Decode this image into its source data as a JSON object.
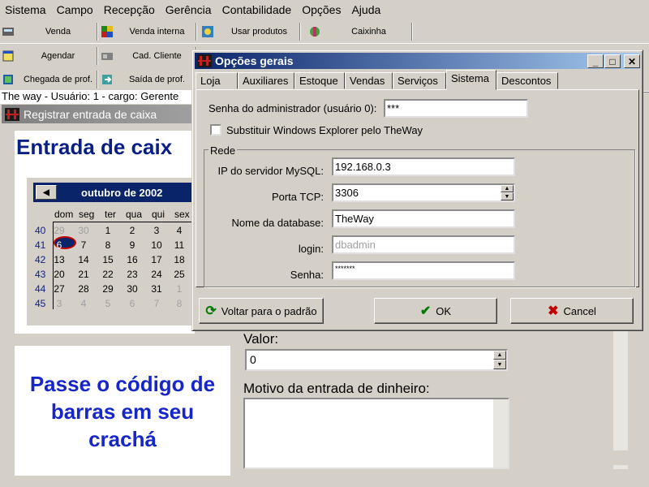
{
  "menu": [
    "Sistema",
    "Campo",
    "Recepção",
    "Gerência",
    "Contabilidade",
    "Opções",
    "Ajuda"
  ],
  "toolbar1": [
    "Venda",
    "Venda interna",
    "Usar produtos",
    "Caixinha"
  ],
  "toolbar2": [
    "Agendar",
    "Cad. Cliente"
  ],
  "toolbar3": [
    "Chegada de prof.",
    "Saída de prof."
  ],
  "status_line": "The way - Usuário: 1 - cargo: Gerente",
  "caixa": {
    "window_title": "Registrar entrada de caixa",
    "heading": "Entrada de caix",
    "calendar": {
      "month": "outubro de 2002",
      "dow": [
        "dom",
        "seg",
        "ter",
        "qua",
        "qui",
        "sex"
      ],
      "weeks": [
        {
          "wk": "40",
          "days": [
            "29",
            "30",
            "1",
            "2",
            "3",
            "4"
          ]
        },
        {
          "wk": "41",
          "days": [
            "6",
            "7",
            "8",
            "9",
            "10",
            "11"
          ]
        },
        {
          "wk": "42",
          "days": [
            "13",
            "14",
            "15",
            "16",
            "17",
            "18"
          ]
        },
        {
          "wk": "43",
          "days": [
            "20",
            "21",
            "22",
            "23",
            "24",
            "25"
          ]
        },
        {
          "wk": "44",
          "days": [
            "27",
            "28",
            "29",
            "30",
            "31",
            "1"
          ]
        },
        {
          "wk": "45",
          "days": [
            "3",
            "4",
            "5",
            "6",
            "7",
            "8"
          ]
        }
      ]
    },
    "barcode_text": "Passe o código de barras em seu crachá",
    "valor_label": "Valor:",
    "valor_value": "0",
    "motivo_label": "Motivo da entrada de dinheiro:"
  },
  "dialog": {
    "title": "Opções gerais",
    "tabs": [
      "Loja",
      "Auxiliares",
      "Estoque",
      "Vendas",
      "Serviços",
      "Sistema",
      "Descontos"
    ],
    "active_tab": "Sistema",
    "admin_password_label": "Senha do administrador (usuário 0):",
    "admin_password_value": "***",
    "checkbox_label": "Substituir Windows Explorer pelo TheWay",
    "group_label": "Rede",
    "mysql_label": "IP do servidor MySQL:",
    "mysql_value": "192.168.0.3",
    "port_label": "Porta TCP:",
    "port_value": "3306",
    "db_label": "Nome da database:",
    "db_value": "TheWay",
    "login_label": "login:",
    "login_value": "dbadmin",
    "senha_label": "Senha:",
    "senha_value": "*******",
    "btn_default": "Voltar para o padrão",
    "btn_ok": "OK",
    "btn_cancel": "Cancel"
  },
  "colors": {
    "title_active": "#0a246a",
    "heading_blue": "#0a1f86",
    "barcode_blue": "#1726c9",
    "cancel_red": "#c00000",
    "ok_green": "#007a00"
  }
}
